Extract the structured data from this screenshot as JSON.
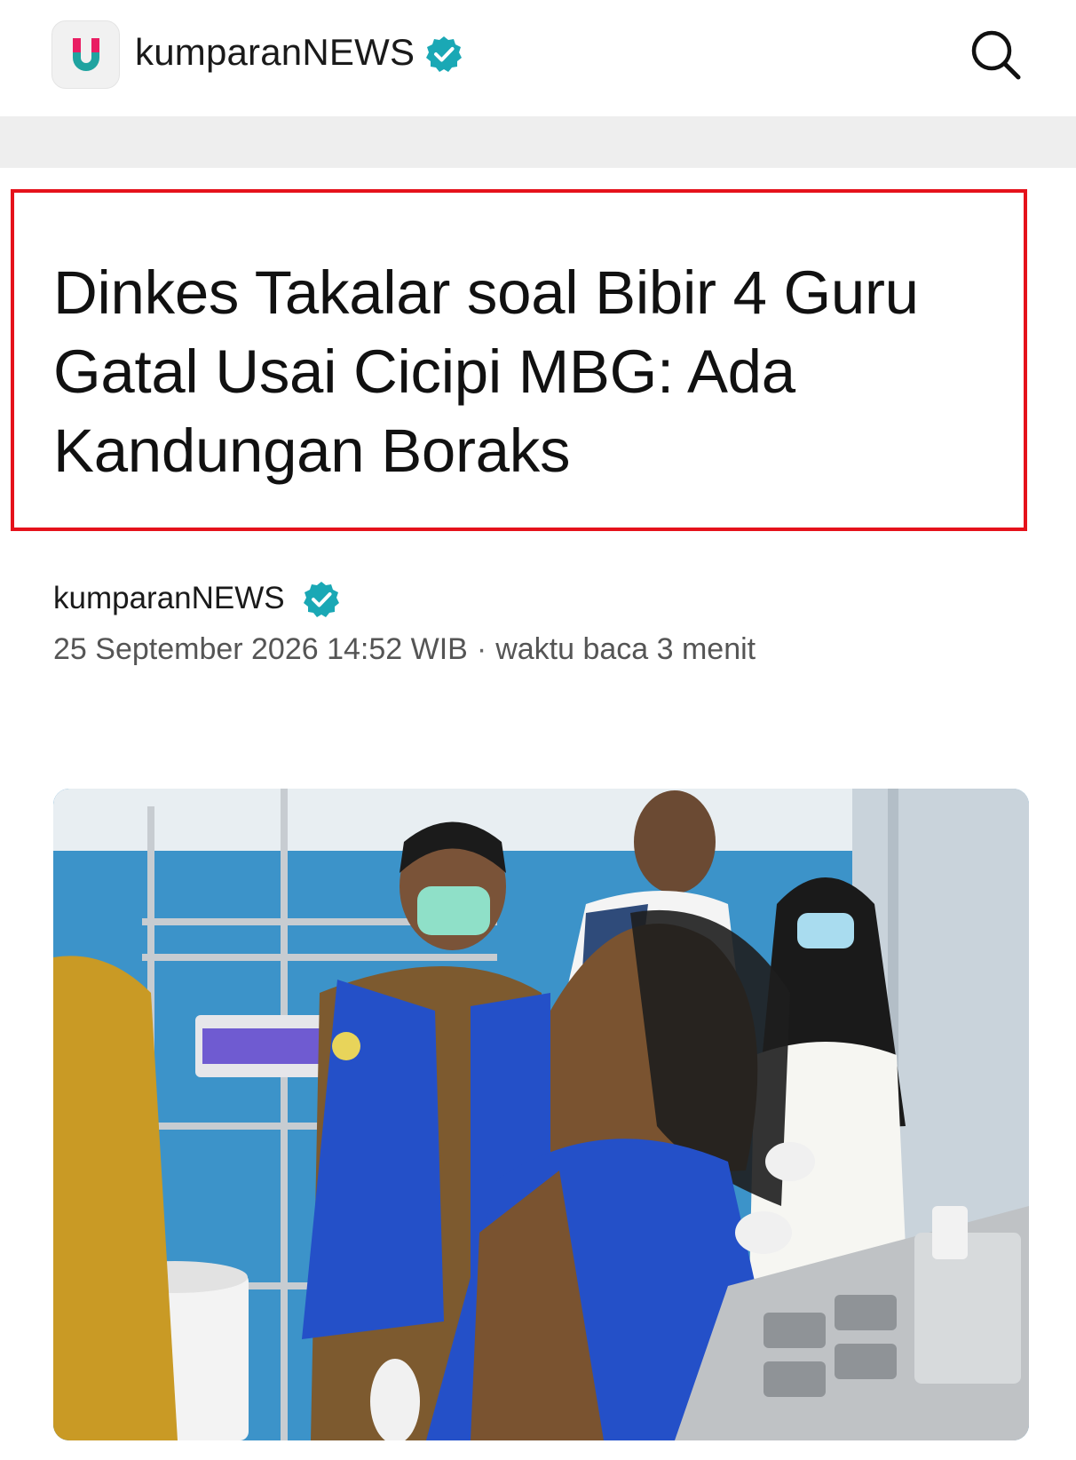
{
  "header": {
    "brand": "kumparanNEWS",
    "logo_letter": "U",
    "search_icon": "search-icon",
    "verified_icon": "verified-badge-icon"
  },
  "article": {
    "headline": "Dinkes Takalar soal Bibir 4 Guru Gatal Usai Cicipi MBG: Ada Kandungan Boraks",
    "author": "kumparanNEWS",
    "datetime": "25 September 2026 14:52 WIB",
    "separator": "·",
    "read_time": "waktu baca 3 menit"
  },
  "colors": {
    "brand_red": "#e5121b",
    "brand_teal": "#1fa3a0",
    "verified": "#1aa8b5"
  }
}
